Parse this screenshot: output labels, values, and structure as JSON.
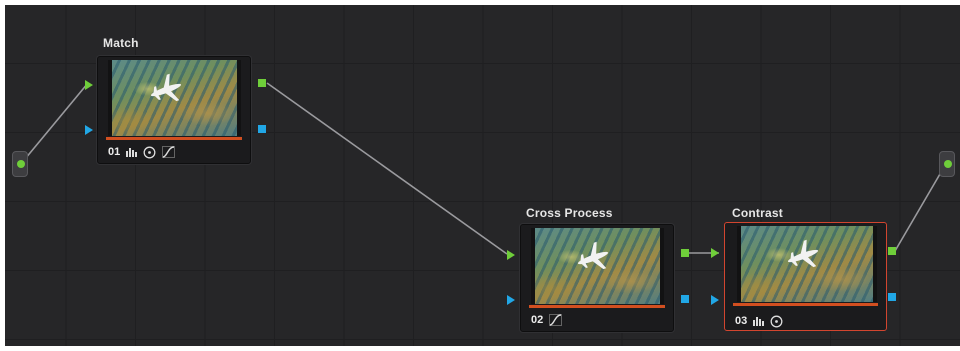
{
  "nodes": [
    {
      "title": "Match",
      "number": "01",
      "tools": [
        "color-bars-icon",
        "circle-dot-icon",
        "curve-icon"
      ],
      "selected": false
    },
    {
      "title": "Cross Process",
      "number": "02",
      "tools": [
        "curve-icon"
      ],
      "selected": false
    },
    {
      "title": "Contrast",
      "number": "03",
      "tools": [
        "color-bars-icon",
        "circle-dot-icon"
      ],
      "selected": true
    }
  ],
  "colors": {
    "background": "#262628",
    "grid": "#1f1f21",
    "rgb_port": "#6fce3a",
    "alpha_port": "#21a7e6",
    "selection_border": "#d2452f",
    "node_bar": "#d24f20",
    "link_line": "#9a9a9e"
  }
}
